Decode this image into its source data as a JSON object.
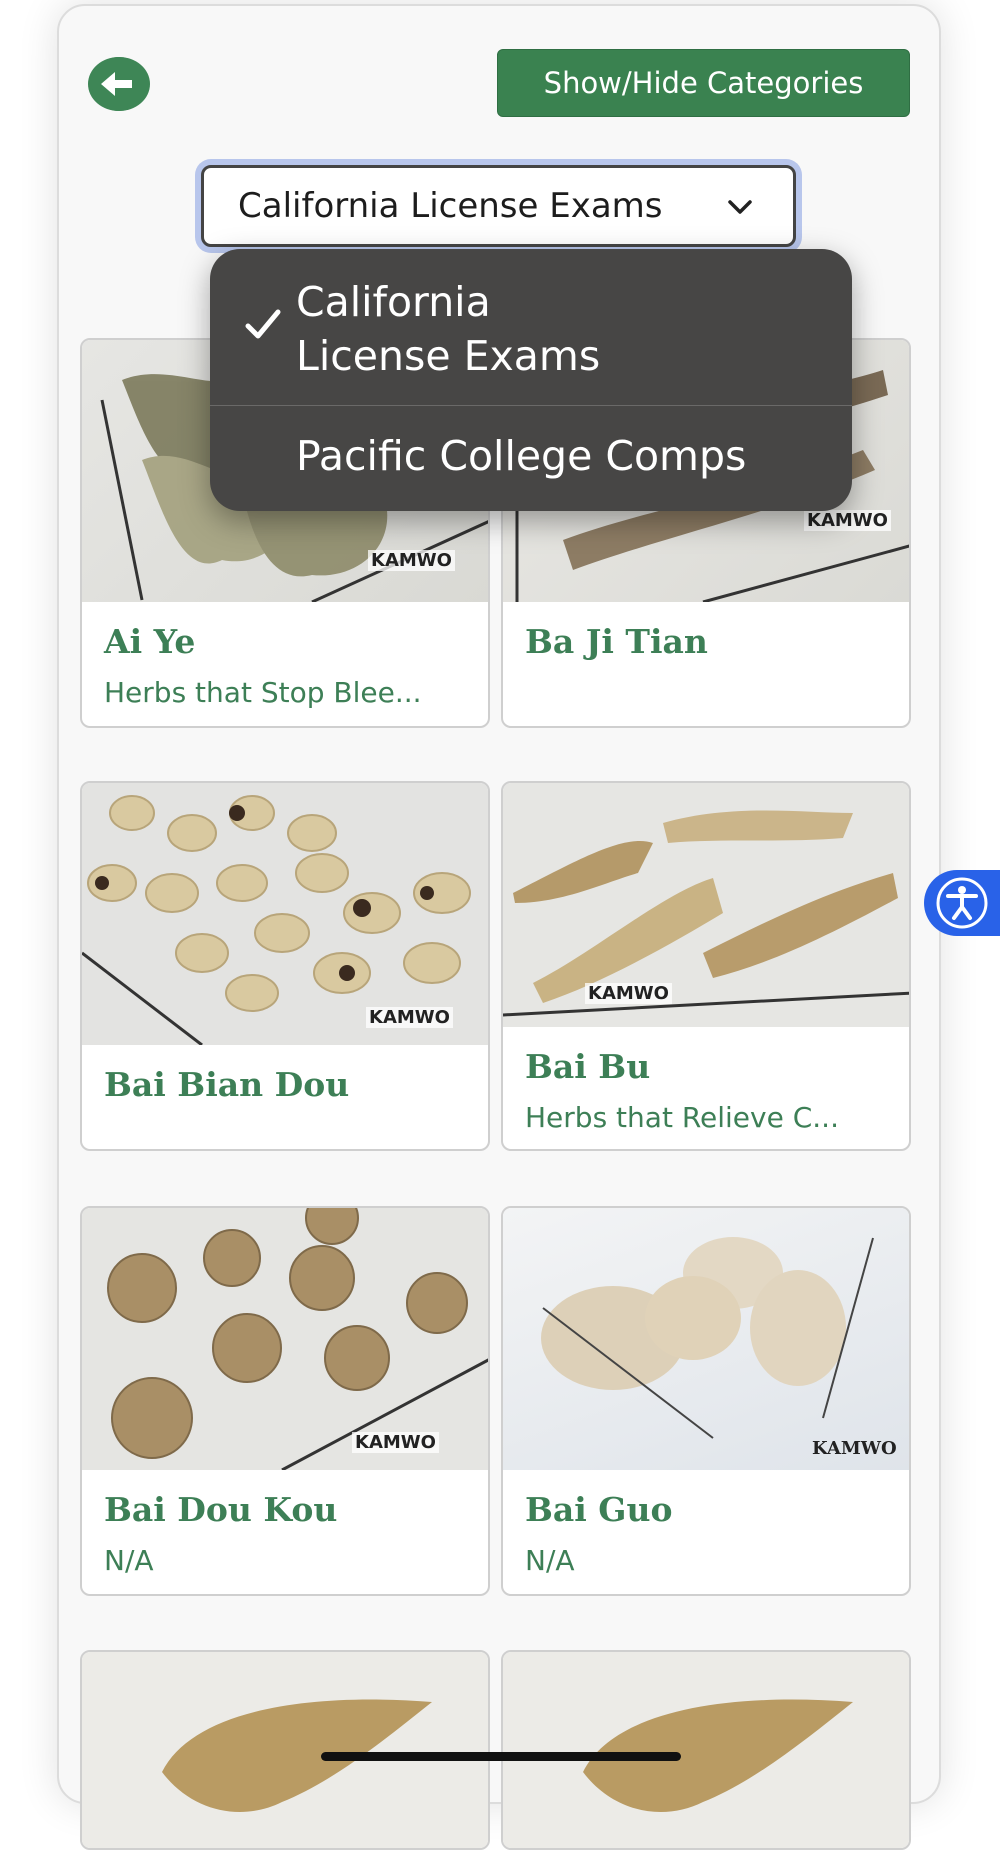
{
  "header": {
    "back_icon": "arrow-left-icon",
    "show_hide_label": "Show/Hide Categories"
  },
  "select": {
    "value": "California License Exams",
    "options": [
      {
        "label": "California License Exams",
        "label_line1": "California",
        "label_line2": "License Exams",
        "selected": true
      },
      {
        "label": "Pacific College Comps",
        "selected": false
      }
    ]
  },
  "herbs": [
    {
      "name": "Ai Ye",
      "category": "Herbs that Stop Blee...",
      "watermark": "KAMWO"
    },
    {
      "name": "Ba Ji Tian",
      "category": "",
      "watermark": "KAMWO"
    },
    {
      "name": "Bai Bian Dou",
      "category": "",
      "watermark": "KAMWO"
    },
    {
      "name": "Bai Bu",
      "category": "Herbs that Relieve C...",
      "watermark": "KAMWO"
    },
    {
      "name": "Bai Dou Kou",
      "category": "N/A",
      "watermark": "KAMWO"
    },
    {
      "name": "Bai Guo",
      "category": "N/A",
      "watermark": "KAMWO"
    }
  ],
  "colors": {
    "accent": "#3a8250",
    "text_green": "#3d7f56",
    "a11y_blue": "#2962e8"
  }
}
